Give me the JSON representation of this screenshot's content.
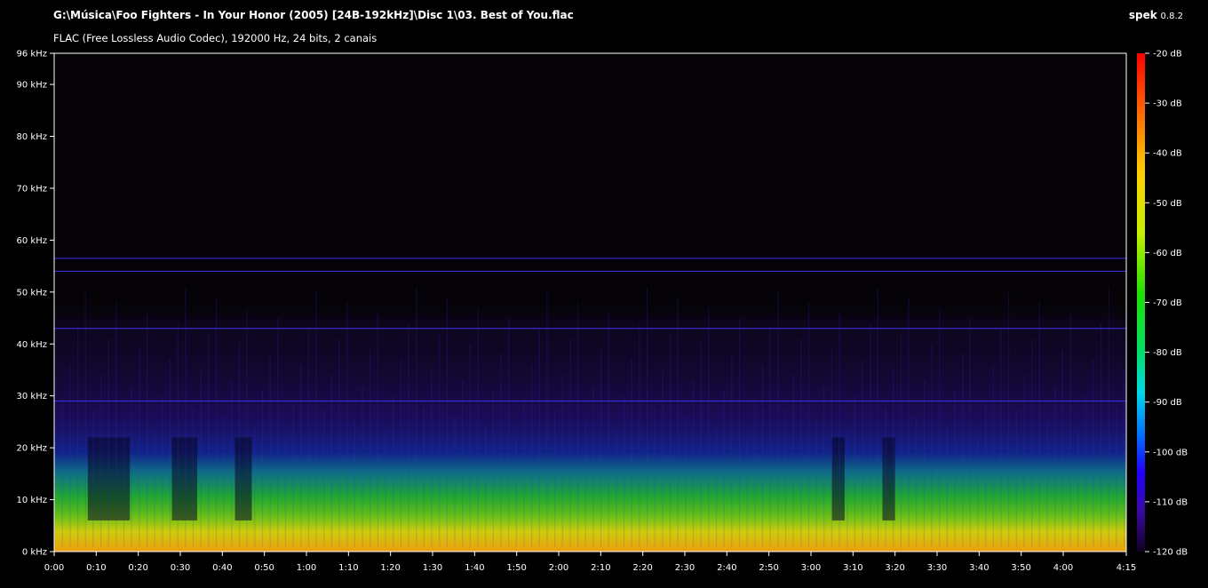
{
  "header": {
    "file_path": "G:\\Música\\Foo Fighters - In Your Honor (2005) [24B-192kHz]\\Disc 1\\03. Best of You.flac",
    "app_name": "spek",
    "app_version": "0.8.2",
    "audio_info": "FLAC (Free Lossless Audio Codec), 192000 Hz, 24 bits, 2 canais"
  },
  "frequency_axis": {
    "unit": "kHz",
    "ticks": [
      "96 kHz",
      "90 kHz",
      "80 kHz",
      "70 kHz",
      "60 kHz",
      "50 kHz",
      "40 kHz",
      "30 kHz",
      "20 kHz",
      "10 kHz",
      "0 kHz"
    ],
    "values": [
      96,
      90,
      80,
      70,
      60,
      50,
      40,
      30,
      20,
      10,
      0
    ]
  },
  "time_axis": {
    "ticks": [
      "0:00",
      "0:10",
      "0:20",
      "0:30",
      "0:40",
      "0:50",
      "1:00",
      "1:10",
      "1:20",
      "1:30",
      "1:40",
      "1:50",
      "2:00",
      "2:10",
      "2:20",
      "2:30",
      "2:40",
      "2:50",
      "3:00",
      "3:10",
      "3:20",
      "3:30",
      "3:40",
      "3:50",
      "4:00",
      "4:15"
    ],
    "seconds": [
      0,
      10,
      20,
      30,
      40,
      50,
      60,
      70,
      80,
      90,
      100,
      110,
      120,
      130,
      140,
      150,
      160,
      170,
      180,
      190,
      200,
      210,
      220,
      230,
      240,
      255
    ],
    "duration_seconds": 255
  },
  "level_scale": {
    "ticks": [
      "-20 dB",
      "-30 dB",
      "-40 dB",
      "-50 dB",
      "-60 dB",
      "-70 dB",
      "-80 dB",
      "-90 dB",
      "-100 dB",
      "-110 dB",
      "-120 dB"
    ],
    "values": [
      -20,
      -30,
      -40,
      -50,
      -60,
      -70,
      -80,
      -90,
      -100,
      -110,
      -120
    ]
  },
  "spectrogram": {
    "background": "#050308",
    "tones_khz": [
      56.5,
      54,
      43,
      29
    ],
    "tone_color": "#3a2bd0"
  }
}
